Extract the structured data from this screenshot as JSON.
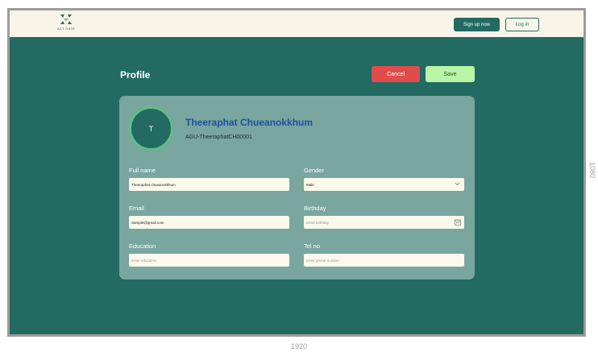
{
  "header": {
    "logo_text": "ACT GATE",
    "signup_label": "Sign up now",
    "login_label": "Log in"
  },
  "profile": {
    "title": "Profile",
    "cancel_label": "Cancel",
    "save_label": "Save",
    "avatar_initial": "T",
    "name": "Theeraphat Chueanokkhum",
    "user_id": "AGU-TheeraphatCH00001"
  },
  "form": {
    "full_name": {
      "label": "Full name",
      "value": "Theeraphat chueanokkhum"
    },
    "gender": {
      "label": "Gender",
      "value": "Male"
    },
    "email": {
      "label": "Email",
      "value": "Sample@gmail.com"
    },
    "birthday": {
      "label": "Birthday",
      "placeholder": "Enter birthday"
    },
    "education": {
      "label": "Education",
      "placeholder": "Enter education"
    },
    "tel": {
      "label": "Tel no",
      "placeholder": "Enter phone number"
    }
  },
  "canvas_annotations": {
    "width_label": "1920",
    "height_label": "1080"
  },
  "colors": {
    "brand_teal": "#236a62",
    "header_bg": "#f8f5e8",
    "card_bg": "#79a69e",
    "cancel_red": "#e04c4c",
    "save_green": "#b8f5a6",
    "name_blue": "#1f4fa0"
  }
}
